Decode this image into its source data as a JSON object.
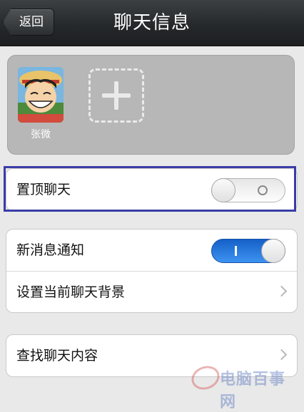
{
  "header": {
    "back_label": "返回",
    "title": "聊天信息"
  },
  "members": {
    "items": [
      {
        "name": "张微"
      }
    ],
    "add_icon": "plus-icon"
  },
  "settings": {
    "pin_chat": {
      "label": "置顶聊天",
      "enabled": false
    },
    "notifications": {
      "label": "新消息通知",
      "enabled": true
    },
    "background": {
      "label": "设置当前聊天背景"
    },
    "search": {
      "label": "查找聊天内容"
    }
  },
  "colors": {
    "header": "#26292c",
    "toggle_on": "#2a7be0",
    "highlight_border": "#3a3da6",
    "members_bg": "#b7b7b7"
  },
  "watermark": {
    "text": "电脑百事网"
  }
}
